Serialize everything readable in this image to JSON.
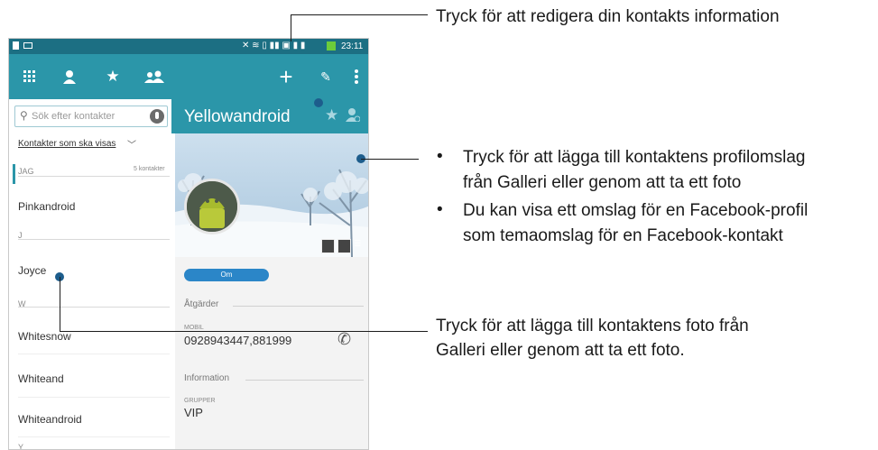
{
  "statusbar": {
    "time": "23:11"
  },
  "search": {
    "placeholder": "Sök efter kontakter"
  },
  "filter": {
    "label": "Kontakter som ska visas"
  },
  "sections": [
    {
      "label": "JAG",
      "count": "5 kontakter"
    },
    {
      "label": "J"
    },
    {
      "label": "W"
    },
    {
      "label": "Y"
    }
  ],
  "contacts": [
    "Pinkandroid",
    "Joyce",
    "Whitesnow",
    "Whiteand",
    "Whiteandroid"
  ],
  "detail": {
    "name": "Yellowandroid",
    "tab_label": "Om",
    "actions_title": "Åtgärder",
    "mobile_label": "MOBIL",
    "mobile_value": "0928943447,881999",
    "information_title": "Information",
    "groups_label": "GRUPPER",
    "groups_value": "VIP"
  },
  "captions": {
    "edit": "Tryck för att redigera din kontakts information",
    "cover_1a": "Tryck för att lägga till kontaktens profilomslag",
    "cover_1b": "från Galleri eller genom att ta ett foto",
    "cover_2a": "Du kan visa ett omslag för en Facebook-profil",
    "cover_2b": "som temaomslag för en Facebook-kontakt",
    "photo_a": "Tryck för att lägga till kontaktens foto från",
    "photo_b": "Galleri eller genom att ta ett foto."
  },
  "colors": {
    "statusbar": "#1c6f83",
    "toolbar": "#2b96a9",
    "callout_dot": "#1d5d8c",
    "tab": "#2b86c8"
  }
}
